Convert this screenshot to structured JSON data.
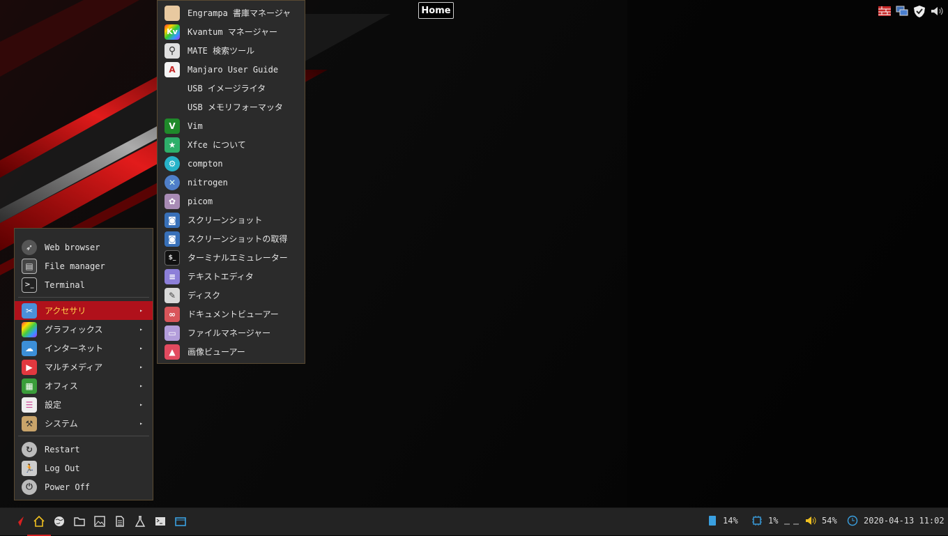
{
  "topbar": {
    "workspace_label": "Home",
    "tray_icons": [
      "network-error-icon",
      "network-icon",
      "shield-icon",
      "volume-icon"
    ]
  },
  "main_menu": {
    "favorites": [
      {
        "label": "Web browser",
        "icon": "web-browser-icon"
      },
      {
        "label": "File manager",
        "icon": "file-manager-icon"
      },
      {
        "label": "Terminal",
        "icon": "terminal-icon"
      }
    ],
    "categories": [
      {
        "label": "アクセサリ",
        "icon": "accessories-icon",
        "active": true,
        "color": "#4a90d9"
      },
      {
        "label": "グラフィックス",
        "icon": "graphics-icon",
        "color": "#9b59b6"
      },
      {
        "label": "インターネット",
        "icon": "internet-icon",
        "color": "#3c8fd8"
      },
      {
        "label": "マルチメディア",
        "icon": "multimedia-icon",
        "color": "#e2383f"
      },
      {
        "label": "オフィス",
        "icon": "office-icon",
        "color": "#3a9d3a"
      },
      {
        "label": "設定",
        "icon": "settings-icon",
        "color": "#d04f9a"
      },
      {
        "label": "システム",
        "icon": "system-icon",
        "color": "#c9a46a"
      }
    ],
    "session": [
      {
        "label": "Restart",
        "icon": "restart-icon"
      },
      {
        "label": "Log Out",
        "icon": "logout-icon"
      },
      {
        "label": "Power Off",
        "icon": "power-icon"
      }
    ],
    "submenu_arrow": "▸"
  },
  "sub_menu": {
    "items": [
      {
        "label": "Engrampa 書庫マネージャ",
        "icon": "archive-icon",
        "bg": "#e8c9a0",
        "glyph": ""
      },
      {
        "label": "Kvantum マネージャー",
        "icon": "kvantum-icon",
        "bg": "#7b3fbf",
        "glyph": "Kv"
      },
      {
        "label": "MATE 検索ツール",
        "icon": "search-icon",
        "bg": "#e0e0e0",
        "glyph": "⚲"
      },
      {
        "label": "Manjaro User Guide",
        "icon": "pdf-icon",
        "bg": "#f5f5f5",
        "glyph": "A"
      },
      {
        "label": "USB イメージライタ",
        "icon": "",
        "bg": "",
        "glyph": ""
      },
      {
        "label": "USB メモリフォーマッタ",
        "icon": "",
        "bg": "",
        "glyph": ""
      },
      {
        "label": "Vim",
        "icon": "vim-icon",
        "bg": "#1f8a2a",
        "glyph": "V"
      },
      {
        "label": "Xfce について",
        "icon": "xfce-icon",
        "bg": "#2eaf6a",
        "glyph": "★"
      },
      {
        "label": "compton",
        "icon": "compton-icon",
        "bg": "#27b3c9",
        "glyph": "⚙"
      },
      {
        "label": "nitrogen",
        "icon": "nitrogen-icon",
        "bg": "#4f7fc9",
        "glyph": "✕"
      },
      {
        "label": "picom",
        "icon": "picom-icon",
        "bg": "#a88bb5",
        "glyph": "✿"
      },
      {
        "label": "スクリーンショット",
        "icon": "screenshot-icon",
        "bg": "#3870b8",
        "glyph": "◙"
      },
      {
        "label": "スクリーンショットの取得",
        "icon": "screenshot-capture-icon",
        "bg": "#3870b8",
        "glyph": "◙"
      },
      {
        "label": "ターミナルエミュレーター",
        "icon": "terminal-emulator-icon",
        "bg": "#111111",
        "glyph": "$_"
      },
      {
        "label": "テキストエディタ",
        "icon": "text-editor-icon",
        "bg": "#8c7fd9",
        "glyph": "≡"
      },
      {
        "label": "ディスク",
        "icon": "disks-icon",
        "bg": "#d8d8d8",
        "glyph": "✎"
      },
      {
        "label": "ドキュメントビューアー",
        "icon": "document-viewer-icon",
        "bg": "#d9555a",
        "glyph": "∞"
      },
      {
        "label": "ファイルマネージャー",
        "icon": "folder-icon",
        "bg": "#b39ddb",
        "glyph": "▭"
      },
      {
        "label": "画像ビューアー",
        "icon": "image-viewer-icon",
        "bg": "#e24a5f",
        "glyph": "▲"
      }
    ]
  },
  "taskbar": {
    "launchers": [
      "menu-rocket-icon",
      "home-icon",
      "globe-icon",
      "folder-icon",
      "image-icon",
      "document-icon",
      "flask-icon",
      "terminal-icon",
      "window-icon"
    ],
    "memory": "14%",
    "cpu": "1%",
    "volume": "54%",
    "datetime": "2020-04-13 11:02"
  },
  "colors": {
    "accent": "#b0111b",
    "menu_bg": "#2b2b2b",
    "taskbar_bg": "#232323"
  }
}
